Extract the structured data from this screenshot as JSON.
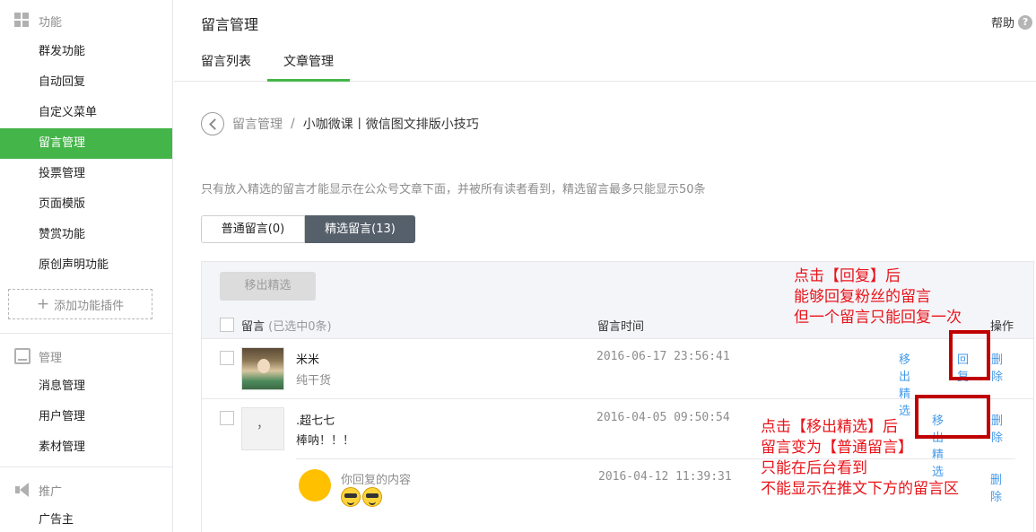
{
  "sidebar": {
    "groups": [
      {
        "title": "功能",
        "icon": "grid-icon"
      },
      {
        "title": "管理",
        "icon": "inbox-icon"
      },
      {
        "title": "推广",
        "icon": "megaphone-icon"
      }
    ],
    "function_items": [
      "群发功能",
      "自动回复",
      "自定义菜单",
      "留言管理",
      "投票管理",
      "页面模版",
      "赞赏功能",
      "原创声明功能"
    ],
    "active_item": "留言管理",
    "add_plugin_label": "添加功能插件",
    "manage_items": [
      "消息管理",
      "用户管理",
      "素材管理"
    ],
    "promo_items": [
      "广告主"
    ]
  },
  "header": {
    "title": "留言管理",
    "help_label": "帮助",
    "help_icon_glyph": "?"
  },
  "tabs": [
    {
      "label": "留言列表",
      "active": false
    },
    {
      "label": "文章管理",
      "active": true
    }
  ],
  "breadcrumb": {
    "parent": "留言管理",
    "separator": "/",
    "current": "小咖微课丨微信图文排版小技巧"
  },
  "tip": "只有放入精选的留言才能显示在公众号文章下面，并被所有读者看到，精选留言最多只能显示50条",
  "segments": [
    {
      "label": "普通留言(0)",
      "active": false
    },
    {
      "label": "精选留言(13)",
      "active": true
    }
  ],
  "toolbar": {
    "remove_button": "移出精选",
    "col_comment": "留言",
    "col_selected": "(已选中0条)",
    "col_time": "留言时间",
    "col_ops": "操作"
  },
  "comments": [
    {
      "nickname": "米米",
      "content": "纯干货",
      "time": "2016-06-17 23:56:41",
      "ops": [
        "移出精选",
        "回复",
        "删除"
      ]
    },
    {
      "nickname": ".超七七",
      "avatar_text": "，",
      "content": "棒呐！！！",
      "time": "2016-04-05 09:50:54",
      "ops": [
        "移出精选",
        "删除"
      ],
      "reply": {
        "label": "你回复的内容",
        "time": "2016-04-12 11:39:31",
        "delete": "删除",
        "emoji": [
          "sunglasses-emoji",
          "sunglasses-emoji"
        ]
      }
    }
  ],
  "annotations": {
    "reply_note": [
      "点击【回复】后",
      "能够回复粉丝的留言",
      "但一个留言只能回复一次"
    ],
    "remove_note": [
      "点击【移出精选】后",
      "留言变为【普通留言】",
      "只能在后台看到",
      "不能显示在推文下方的留言区"
    ],
    "color": "#e8141a",
    "box_color": "#c00000"
  },
  "colors": {
    "accent_green": "#44b549",
    "link_blue": "#459ae9",
    "segment_active": "#56606b"
  }
}
